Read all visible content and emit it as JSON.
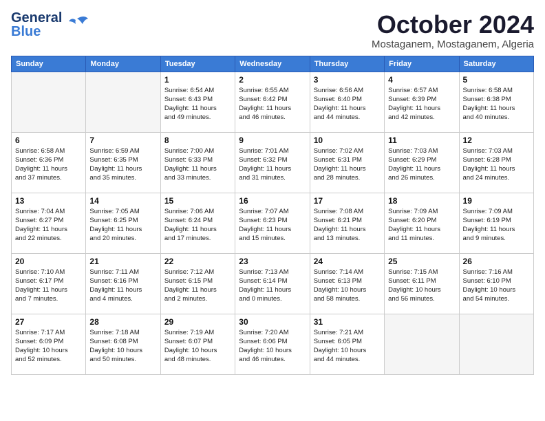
{
  "header": {
    "logo_line1": "General",
    "logo_line2": "Blue",
    "month_title": "October 2024",
    "subtitle": "Mostaganem, Mostaganem, Algeria"
  },
  "days_of_week": [
    "Sunday",
    "Monday",
    "Tuesday",
    "Wednesday",
    "Thursday",
    "Friday",
    "Saturday"
  ],
  "weeks": [
    [
      {
        "day": "",
        "info": ""
      },
      {
        "day": "",
        "info": ""
      },
      {
        "day": "1",
        "info": "Sunrise: 6:54 AM\nSunset: 6:43 PM\nDaylight: 11 hours\nand 49 minutes."
      },
      {
        "day": "2",
        "info": "Sunrise: 6:55 AM\nSunset: 6:42 PM\nDaylight: 11 hours\nand 46 minutes."
      },
      {
        "day": "3",
        "info": "Sunrise: 6:56 AM\nSunset: 6:40 PM\nDaylight: 11 hours\nand 44 minutes."
      },
      {
        "day": "4",
        "info": "Sunrise: 6:57 AM\nSunset: 6:39 PM\nDaylight: 11 hours\nand 42 minutes."
      },
      {
        "day": "5",
        "info": "Sunrise: 6:58 AM\nSunset: 6:38 PM\nDaylight: 11 hours\nand 40 minutes."
      }
    ],
    [
      {
        "day": "6",
        "info": "Sunrise: 6:58 AM\nSunset: 6:36 PM\nDaylight: 11 hours\nand 37 minutes."
      },
      {
        "day": "7",
        "info": "Sunrise: 6:59 AM\nSunset: 6:35 PM\nDaylight: 11 hours\nand 35 minutes."
      },
      {
        "day": "8",
        "info": "Sunrise: 7:00 AM\nSunset: 6:33 PM\nDaylight: 11 hours\nand 33 minutes."
      },
      {
        "day": "9",
        "info": "Sunrise: 7:01 AM\nSunset: 6:32 PM\nDaylight: 11 hours\nand 31 minutes."
      },
      {
        "day": "10",
        "info": "Sunrise: 7:02 AM\nSunset: 6:31 PM\nDaylight: 11 hours\nand 28 minutes."
      },
      {
        "day": "11",
        "info": "Sunrise: 7:03 AM\nSunset: 6:29 PM\nDaylight: 11 hours\nand 26 minutes."
      },
      {
        "day": "12",
        "info": "Sunrise: 7:03 AM\nSunset: 6:28 PM\nDaylight: 11 hours\nand 24 minutes."
      }
    ],
    [
      {
        "day": "13",
        "info": "Sunrise: 7:04 AM\nSunset: 6:27 PM\nDaylight: 11 hours\nand 22 minutes."
      },
      {
        "day": "14",
        "info": "Sunrise: 7:05 AM\nSunset: 6:25 PM\nDaylight: 11 hours\nand 20 minutes."
      },
      {
        "day": "15",
        "info": "Sunrise: 7:06 AM\nSunset: 6:24 PM\nDaylight: 11 hours\nand 17 minutes."
      },
      {
        "day": "16",
        "info": "Sunrise: 7:07 AM\nSunset: 6:23 PM\nDaylight: 11 hours\nand 15 minutes."
      },
      {
        "day": "17",
        "info": "Sunrise: 7:08 AM\nSunset: 6:21 PM\nDaylight: 11 hours\nand 13 minutes."
      },
      {
        "day": "18",
        "info": "Sunrise: 7:09 AM\nSunset: 6:20 PM\nDaylight: 11 hours\nand 11 minutes."
      },
      {
        "day": "19",
        "info": "Sunrise: 7:09 AM\nSunset: 6:19 PM\nDaylight: 11 hours\nand 9 minutes."
      }
    ],
    [
      {
        "day": "20",
        "info": "Sunrise: 7:10 AM\nSunset: 6:17 PM\nDaylight: 11 hours\nand 7 minutes."
      },
      {
        "day": "21",
        "info": "Sunrise: 7:11 AM\nSunset: 6:16 PM\nDaylight: 11 hours\nand 4 minutes."
      },
      {
        "day": "22",
        "info": "Sunrise: 7:12 AM\nSunset: 6:15 PM\nDaylight: 11 hours\nand 2 minutes."
      },
      {
        "day": "23",
        "info": "Sunrise: 7:13 AM\nSunset: 6:14 PM\nDaylight: 11 hours\nand 0 minutes."
      },
      {
        "day": "24",
        "info": "Sunrise: 7:14 AM\nSunset: 6:13 PM\nDaylight: 10 hours\nand 58 minutes."
      },
      {
        "day": "25",
        "info": "Sunrise: 7:15 AM\nSunset: 6:11 PM\nDaylight: 10 hours\nand 56 minutes."
      },
      {
        "day": "26",
        "info": "Sunrise: 7:16 AM\nSunset: 6:10 PM\nDaylight: 10 hours\nand 54 minutes."
      }
    ],
    [
      {
        "day": "27",
        "info": "Sunrise: 7:17 AM\nSunset: 6:09 PM\nDaylight: 10 hours\nand 52 minutes."
      },
      {
        "day": "28",
        "info": "Sunrise: 7:18 AM\nSunset: 6:08 PM\nDaylight: 10 hours\nand 50 minutes."
      },
      {
        "day": "29",
        "info": "Sunrise: 7:19 AM\nSunset: 6:07 PM\nDaylight: 10 hours\nand 48 minutes."
      },
      {
        "day": "30",
        "info": "Sunrise: 7:20 AM\nSunset: 6:06 PM\nDaylight: 10 hours\nand 46 minutes."
      },
      {
        "day": "31",
        "info": "Sunrise: 7:21 AM\nSunset: 6:05 PM\nDaylight: 10 hours\nand 44 minutes."
      },
      {
        "day": "",
        "info": ""
      },
      {
        "day": "",
        "info": ""
      }
    ]
  ]
}
